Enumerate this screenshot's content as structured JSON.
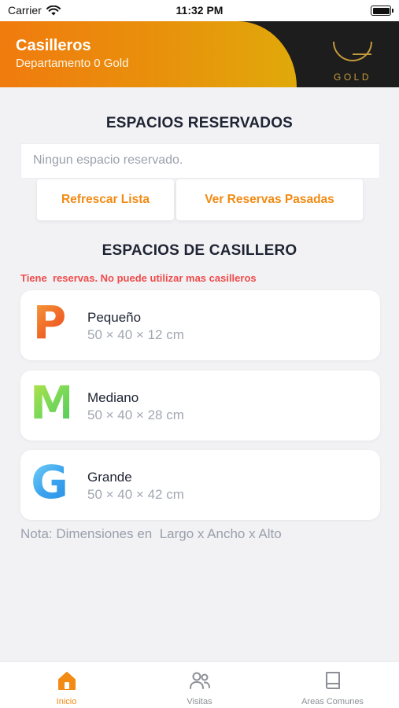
{
  "status_bar": {
    "carrier": "Carrier",
    "time": "11:32 PM"
  },
  "header": {
    "title": "Casilleros",
    "subtitle": "Departamento 0 Gold",
    "logo_text": "GOLD"
  },
  "reserved": {
    "title": "ESPACIOS RESERVADOS",
    "empty_text": "Ningun espacio reservado.",
    "refresh_button": "Refrescar Lista",
    "past_button": "Ver Reservas Pasadas"
  },
  "lockers": {
    "title": "ESPACIOS DE CASILLERO",
    "warning": "Tiene  reservas. No puede utilizar mas casilleros",
    "items": [
      {
        "letter": "P",
        "name": "Pequeño",
        "dims": "50 × 40 × 12 cm",
        "color": "#f06226"
      },
      {
        "letter": "M",
        "name": "Mediano",
        "dims": "50 × 40 × 28 cm",
        "color": "#7ed957"
      },
      {
        "letter": "G",
        "name": "Grande",
        "dims": "50 × 40 × 42 cm",
        "color": "#3aa3ee"
      }
    ],
    "note": "Nota: Dimensiones en  Largo x Ancho x Alto"
  },
  "tabs": [
    {
      "label": "Inicio",
      "icon": "home-icon",
      "active": true
    },
    {
      "label": "Visitas",
      "icon": "users-icon",
      "active": false
    },
    {
      "label": "Areas Comunes",
      "icon": "book-icon",
      "active": false
    }
  ],
  "colors": {
    "accent": "#f28a13",
    "header_gradient_start": "#f07b0e",
    "header_gradient_end": "#e0a90a",
    "warning": "#f04b4b",
    "background": "#f2f2f4"
  }
}
